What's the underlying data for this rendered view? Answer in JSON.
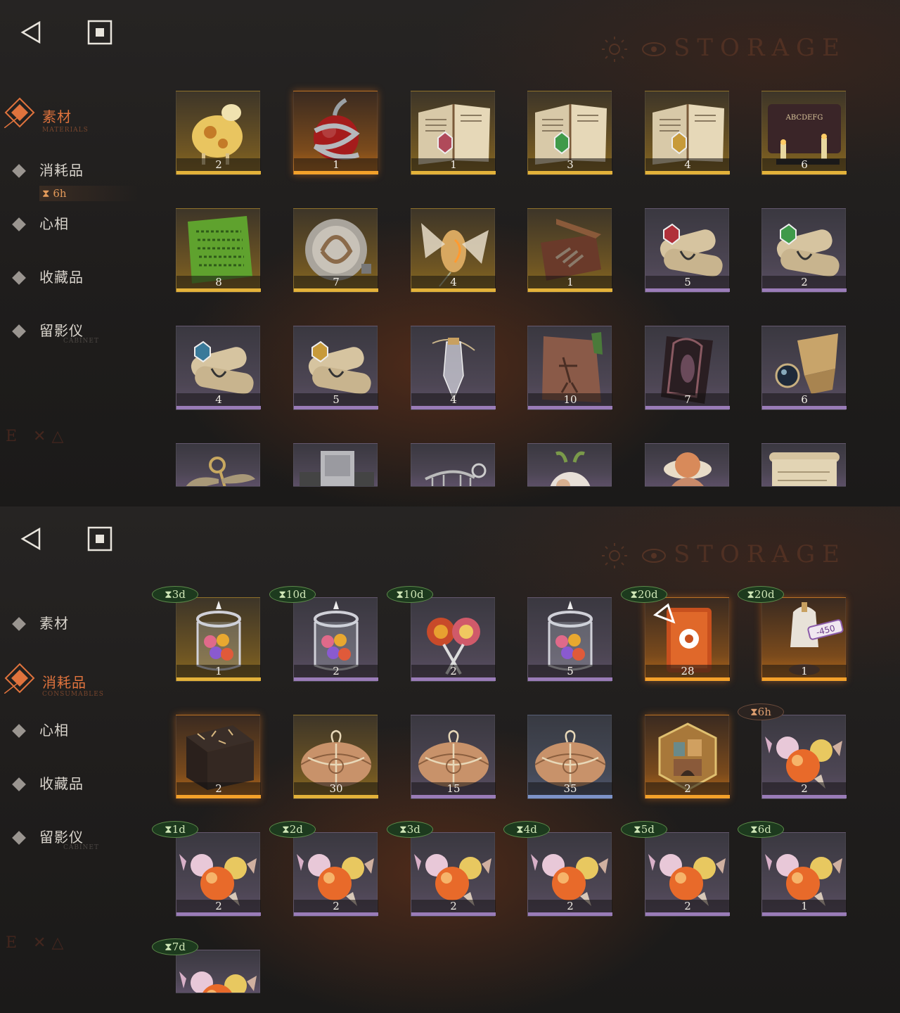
{
  "storage_title": "STORAGE",
  "nav": {
    "materials": {
      "label": "素材",
      "sub": "MATERIALS"
    },
    "consumables": {
      "label": "消耗品",
      "sub": "CONSUMABLES"
    },
    "persona": {
      "label": "心相",
      "sub": ""
    },
    "collectibles": {
      "label": "收藏品",
      "sub": ""
    },
    "projector": {
      "label": "留影仪",
      "sub": "CABINET"
    },
    "consumables_timer": "6h"
  },
  "panel1": {
    "items": [
      {
        "name": "yellow-sheep",
        "count": "2",
        "rarity": "gold"
      },
      {
        "name": "apple-with-snake",
        "count": "1",
        "rarity": "orange"
      },
      {
        "name": "book-red-gem",
        "count": "1",
        "rarity": "gold"
      },
      {
        "name": "book-green-gem",
        "count": "3",
        "rarity": "gold"
      },
      {
        "name": "book-gold-gem",
        "count": "4",
        "rarity": "gold"
      },
      {
        "name": "ouija-board",
        "count": "6",
        "rarity": "gold"
      },
      {
        "name": "green-tablet",
        "count": "8",
        "rarity": "gold"
      },
      {
        "name": "silver-medallion",
        "count": "7",
        "rarity": "gold"
      },
      {
        "name": "moth-bulb",
        "count": "4",
        "rarity": "gold"
      },
      {
        "name": "hand-in-box",
        "count": "1",
        "rarity": "gold"
      },
      {
        "name": "scroll-red-gem",
        "count": "5",
        "rarity": "purple"
      },
      {
        "name": "scroll-green-gem",
        "count": "2",
        "rarity": "purple"
      },
      {
        "name": "scroll-blue-gem",
        "count": "4",
        "rarity": "purple"
      },
      {
        "name": "scroll-gold-gem",
        "count": "5",
        "rarity": "purple"
      },
      {
        "name": "crystal-pendulum",
        "count": "4",
        "rarity": "purple"
      },
      {
        "name": "stone-carving",
        "count": "10",
        "rarity": "purple"
      },
      {
        "name": "gothic-frame",
        "count": "7",
        "rarity": "purple"
      },
      {
        "name": "brass-orb-device",
        "count": "6",
        "rarity": "purple"
      },
      {
        "name": "winged-key",
        "count": "",
        "rarity": "purple"
      },
      {
        "name": "silver-bar",
        "count": "",
        "rarity": "purple"
      },
      {
        "name": "skeleton",
        "count": "",
        "rarity": "purple"
      },
      {
        "name": "fluffy-creature",
        "count": "",
        "rarity": "purple"
      },
      {
        "name": "mask-with-hat",
        "count": "",
        "rarity": "purple"
      },
      {
        "name": "paper-scroll",
        "count": "",
        "rarity": "purple"
      }
    ]
  },
  "panel2": {
    "items": [
      {
        "name": "candy-jar",
        "count": "1",
        "rarity": "gold",
        "expiry": "3d"
      },
      {
        "name": "candy-jar",
        "count": "2",
        "rarity": "purple",
        "expiry": "10d"
      },
      {
        "name": "lollipops",
        "count": "2",
        "rarity": "purple",
        "expiry": "10d"
      },
      {
        "name": "candy-jar",
        "count": "5",
        "rarity": "purple",
        "expiry": ""
      },
      {
        "name": "orange-book",
        "count": "28",
        "rarity": "orange",
        "expiry": "20d"
      },
      {
        "name": "mannequin-ticket",
        "count": "1",
        "rarity": "orange",
        "expiry": "20d"
      },
      {
        "name": "rune-box",
        "count": "2",
        "rarity": "orange",
        "expiry": ""
      },
      {
        "name": "paper-parcel",
        "count": "30",
        "rarity": "gold",
        "expiry": ""
      },
      {
        "name": "paper-parcel",
        "count": "15",
        "rarity": "purple",
        "expiry": ""
      },
      {
        "name": "paper-parcel",
        "count": "35",
        "rarity": "blue",
        "expiry": ""
      },
      {
        "name": "hex-puzzle",
        "count": "2",
        "rarity": "orange",
        "expiry": ""
      },
      {
        "name": "wrapped-candies",
        "count": "2",
        "rarity": "purple",
        "expiry": "6h"
      },
      {
        "name": "wrapped-candies",
        "count": "2",
        "rarity": "purple",
        "expiry": "1d"
      },
      {
        "name": "wrapped-candies",
        "count": "2",
        "rarity": "purple",
        "expiry": "2d"
      },
      {
        "name": "wrapped-candies",
        "count": "2",
        "rarity": "purple",
        "expiry": "3d"
      },
      {
        "name": "wrapped-candies",
        "count": "2",
        "rarity": "purple",
        "expiry": "4d"
      },
      {
        "name": "wrapped-candies",
        "count": "2",
        "rarity": "purple",
        "expiry": "5d"
      },
      {
        "name": "wrapped-candies",
        "count": "1",
        "rarity": "purple",
        "expiry": "6d"
      },
      {
        "name": "wrapped-candies",
        "count": "",
        "rarity": "purple",
        "expiry": "7d"
      }
    ],
    "ticket_tag": "-450"
  },
  "colors": {
    "accent": "#e0733d",
    "gold": "#e3b23a",
    "purple": "#9a7cb8",
    "blue": "#7d93c9",
    "expiry_green": "#5c8a4a"
  }
}
